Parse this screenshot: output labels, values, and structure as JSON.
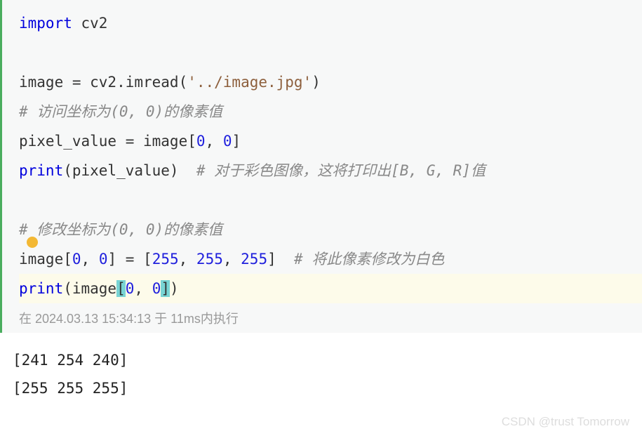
{
  "code": {
    "line1": {
      "keyword": "import",
      "identifier": " cv2"
    },
    "line3_a": "image = cv2.imread(",
    "line3_str": "'../image.jpg'",
    "line3_b": ")",
    "line4_comment": "# 访问坐标为(0, 0)的像素值",
    "line5_a": "pixel_value = image[",
    "line5_n1": "0",
    "line5_comma": ", ",
    "line5_n2": "0",
    "line5_b": "]",
    "line6_a": "print",
    "line6_b": "(pixel_value)  ",
    "line6_comment": "# 对于彩色图像，这将打印出[B, G, R]值",
    "line8_comment": "# 修改坐标为(0, 0)的像素值",
    "line9_a": "image[",
    "line9_n1": "0",
    "line9_c1": ", ",
    "line9_n2": "0",
    "line9_b": "] = [",
    "line9_v1": "255",
    "line9_c2": ", ",
    "line9_v2": "255",
    "line9_c3": ", ",
    "line9_v3": "255",
    "line9_d": "]  ",
    "line9_comment": "# 将此像素修改为白色",
    "line10_a": "print",
    "line10_b": "(image",
    "line10_br1": "[",
    "line10_n1": "0",
    "line10_c": ", ",
    "line10_n2": "0",
    "line10_br2": "]",
    "line10_d": ")"
  },
  "execution": "在 2024.03.13 15:34:13 于 11ms内执行",
  "output": {
    "line1": "[241 254 240]",
    "line2": "[255 255 255]"
  },
  "watermark": "CSDN @trust Tomorrow"
}
